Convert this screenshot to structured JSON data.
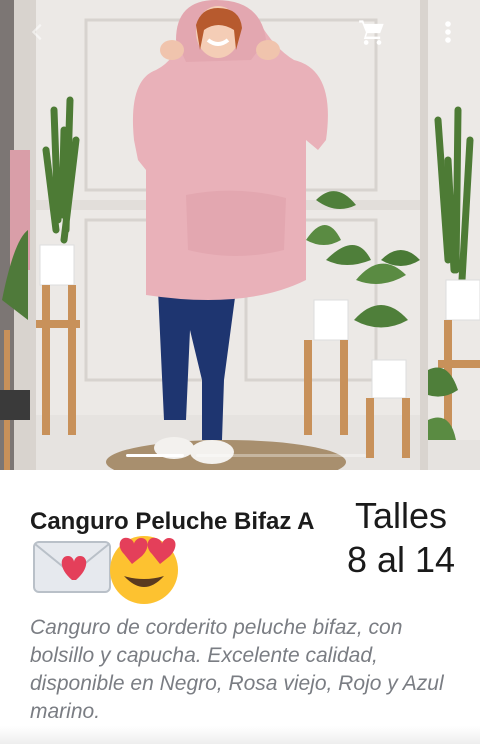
{
  "product": {
    "title": "Canguro Peluche Bifaz A",
    "sizes_line1": "Talles",
    "sizes_line2": "8 al 14",
    "description": "Canguro de corderito peluche bifaz, con bolsillo y capucha. Excelente calidad, disponible en Negro, Rosa viejo, Rojo y Azul marino."
  },
  "toolbar": {
    "back_icon": "chevron-left-icon",
    "cart_icon": "cart-icon",
    "menu_icon": "more-vert-icon"
  },
  "carousel": {
    "current_slide": 1,
    "image_description": "model wearing pink sherpa hoodie"
  },
  "colors": {
    "hoodie": "#e9b1b9",
    "jeans": "#1e3570",
    "wall": "#ece9e6",
    "wood": "#c8915a",
    "title_text": "#1c1c1c",
    "description_text": "#7a7d83"
  }
}
